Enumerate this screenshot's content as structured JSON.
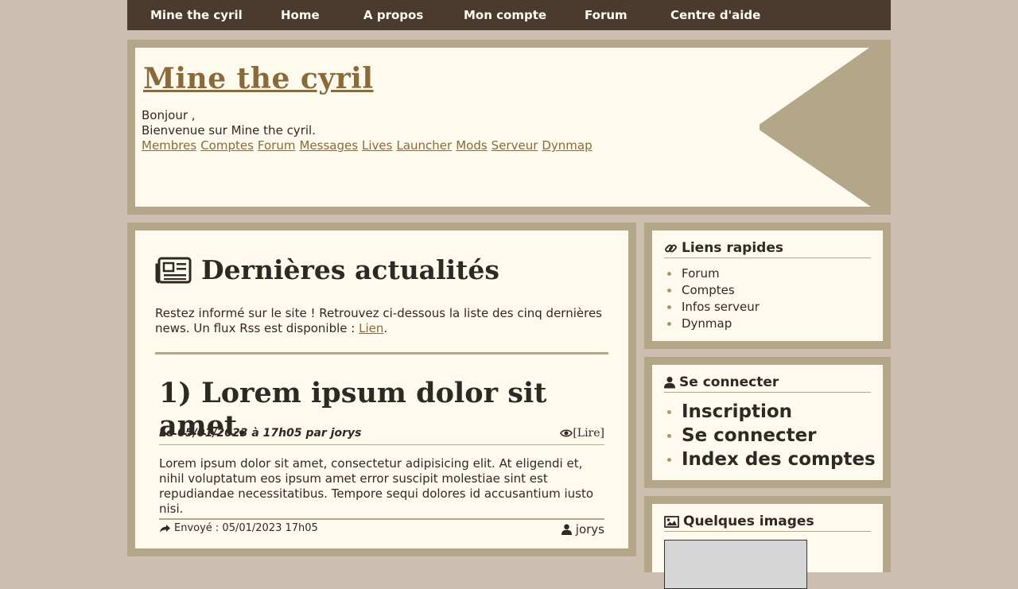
{
  "nav": {
    "brand": "Mine the cyril",
    "items": [
      "Home",
      "A propos",
      "Mon compte",
      "Forum",
      "Centre d'aide"
    ]
  },
  "header": {
    "title": "Mine the cyril",
    "greeting": "Bonjour ,",
    "welcome": "Bienvenue sur Mine the cyril.",
    "links": [
      "Membres",
      "Comptes",
      "Forum",
      "Messages",
      "Lives",
      "Launcher",
      "Mods",
      "Serveur",
      "Dynmap"
    ]
  },
  "news": {
    "title": "Dernières actualités",
    "intro_text": "Restez informé sur le site ! Retrouvez ci-dessous la liste des cinq dernières news. Un flux Rss est disponible : ",
    "rss_link": "Lien",
    "intro_end": "."
  },
  "article": {
    "title": "1) Lorem ipsum dolor sit amet.",
    "meta": "Le 05/01/2023 à 17h05 par jorys",
    "read_label": "[Lire]",
    "body": "Lorem ipsum dolor sit amet, consectetur adipisicing elit. At eligendi et, nihil voluptatum eos ipsum amet error suscipit molestiae sint est repudiandae necessitatibus. Tempore sequi dolores id accusantium iusto nisi.",
    "sent": "Envoyé : 05/01/2023 17h05",
    "author": "jorys"
  },
  "quick_links": {
    "title": "Liens rapides",
    "items": [
      "Forum",
      "Comptes",
      "Infos serveur",
      "Dynmap"
    ]
  },
  "login": {
    "title": "Se connecter",
    "items": [
      "Inscription",
      "Se connecter",
      "Index des comptes"
    ]
  },
  "images": {
    "title": "Quelques images"
  },
  "colors": {
    "nav_bg": "#4a3b2e",
    "frame": "#b4a789",
    "panel": "#fffaee",
    "link": "#8a6a3a",
    "page_bg": "#cdbfb0"
  }
}
